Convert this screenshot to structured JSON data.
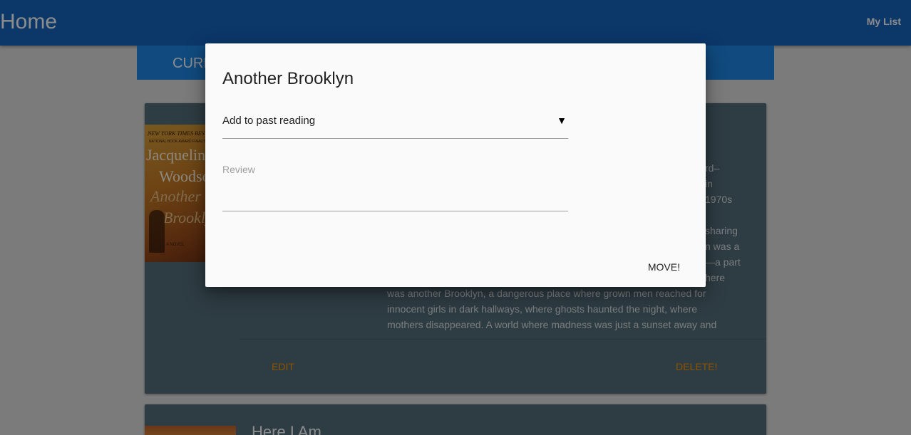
{
  "appbar": {
    "title": "Home",
    "nav_link": "My List"
  },
  "tabs": {
    "current_tab_label": "CURRENT READING"
  },
  "card1": {
    "cover": {
      "top_text": "NEW YORK TIMES BESTSELLER",
      "sub_text": "NATIONAL BOOK AWARD FINALIST",
      "author_line1": "Jacqueline",
      "author_line2": "Woodson",
      "title_line1": "Another",
      "title_line2": "Brooklyn",
      "novel_text": "A NOVEL"
    },
    "description_lines_1": [
      "rd–",
      "in",
      "1970s"
    ],
    "description_lines_2": [
      "sharing",
      "n was a",
      "—a part",
      "here"
    ],
    "description_full": [
      "was another Brooklyn, a dangerous place where grown men reached for",
      "innocent girls in dark hallways, where ghosts haunted the night, where",
      "mothers disappeared. A world where madness was just a sunset away and"
    ],
    "edit_label": "EDIT",
    "delete_label": "DELETE!"
  },
  "card2": {
    "title": "Here I Am"
  },
  "dialog": {
    "title": "Another Brooklyn",
    "select": {
      "value": "Add to past reading",
      "arrow": "▼"
    },
    "review": {
      "label": "Review",
      "value": ""
    },
    "move_label": "MOVE!"
  }
}
